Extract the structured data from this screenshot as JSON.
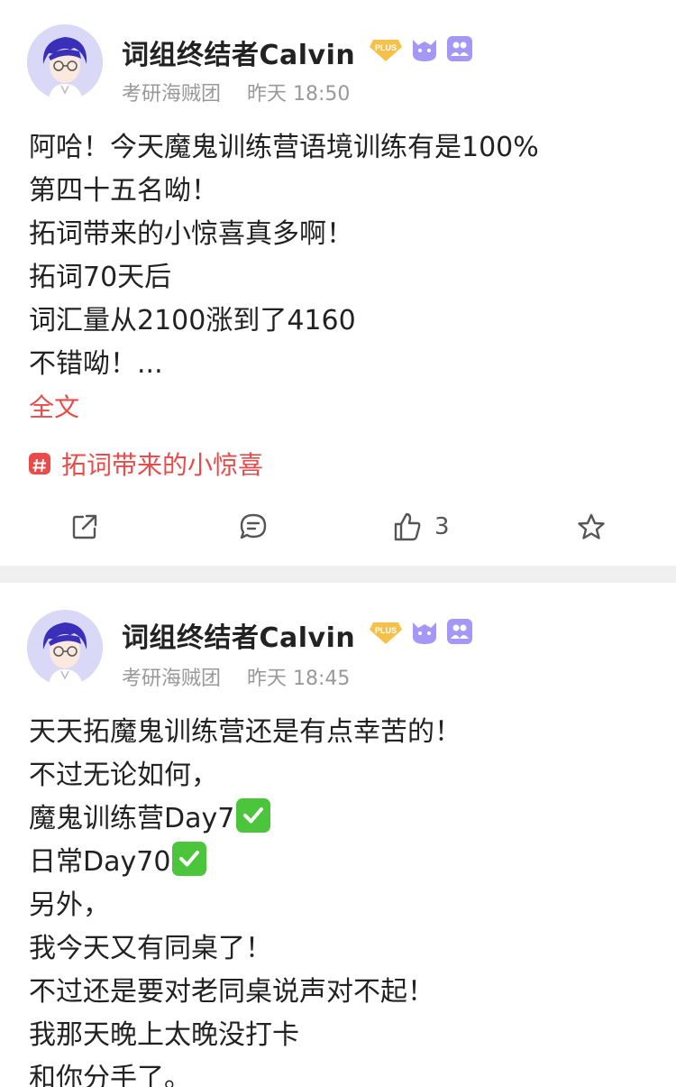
{
  "posts": [
    {
      "username": "词组终结者Calvin",
      "group": "考研海贼团",
      "time": "昨天 18:50",
      "lines": [
        "阿哈！今天魔鬼训练营语境训练有是100%",
        "第四十五名呦！",
        "拓词带来的小惊喜真多啊！",
        "拓词70天后",
        "词汇量从2100涨到了4160",
        "不错呦！..."
      ],
      "fulltext_label": "全文",
      "topic": "拓词带来的小惊喜",
      "like_count": "3",
      "badges": [
        "PLUS"
      ]
    },
    {
      "username": "词组终结者Calvin",
      "group": "考研海贼团",
      "time": "昨天 18:45",
      "lines": [
        "天天拓魔鬼训练营还是有点幸苦的！",
        "不过无论如何，",
        "魔鬼训练营Day7",
        "日常Day70",
        "另外，",
        "我今天又有同桌了！",
        "不过还是要对老同桌说声对不起！",
        "我那天晚上太晚没打卡",
        "和你分手了。"
      ],
      "badges": [
        "PLUS"
      ]
    }
  ],
  "icons": [
    "share-icon",
    "comment-icon",
    "like-icon",
    "star-icon",
    "topic-hash-icon",
    "plus-badge-icon",
    "monster-badge-icon",
    "group-badge-icon",
    "check-mark-icon"
  ],
  "colors": {
    "accent_red": "#e94b4b",
    "badge_purple": "#a497f5",
    "plus_gold": "#f5c14a",
    "check_green": "#4cc43b"
  }
}
